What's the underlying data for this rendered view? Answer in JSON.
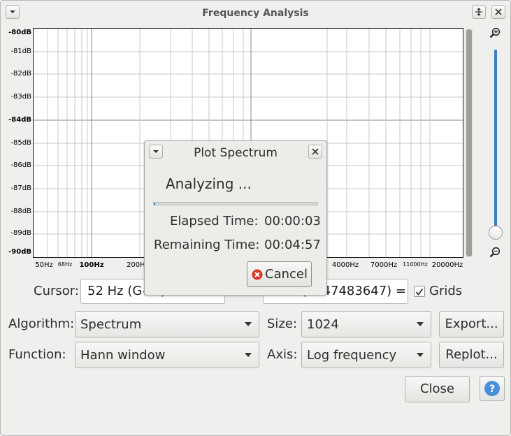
{
  "window": {
    "title": "Frequency Analysis"
  },
  "plot": {
    "y_ticks": [
      "-80dB",
      "-81dB",
      "-82dB",
      "-83dB",
      "-84dB",
      "-85dB",
      "-86dB",
      "-87dB",
      "-88dB",
      "-89dB",
      "-90dB"
    ],
    "x_ticks": [
      "50Hz",
      "68Hz",
      "100Hz",
      "200Hz",
      "4000Hz",
      "7000Hz",
      "11000Hz",
      "20000Hz"
    ]
  },
  "cursor": {
    "label": "Cursor:",
    "value": "52 Hz (G#1)",
    "peak_value": "(2147483647) ="
  },
  "grids": {
    "label": "Grids",
    "checked": true
  },
  "algorithm": {
    "label": "Algorithm:",
    "value": "Spectrum"
  },
  "size": {
    "label": "Size:",
    "value": "1024"
  },
  "function": {
    "label": "Function:",
    "value": "Hann window"
  },
  "axis": {
    "label": "Axis:",
    "value": "Log frequency"
  },
  "buttons": {
    "export": "Export...",
    "replot": "Replot...",
    "close": "Close",
    "help": "?"
  },
  "dialog": {
    "title": "Plot Spectrum",
    "status": "Analyzing ...",
    "progress": 0.01,
    "elapsed_label": "Elapsed Time:",
    "elapsed_value": "00:00:03",
    "remaining_label": "Remaining Time:",
    "remaining_value": "00:04:57",
    "cancel": "Cancel"
  },
  "colors": {
    "accent": "#3d7ec3",
    "cancel_icon": "#d9362b",
    "help_icon": "#4a90d9"
  }
}
